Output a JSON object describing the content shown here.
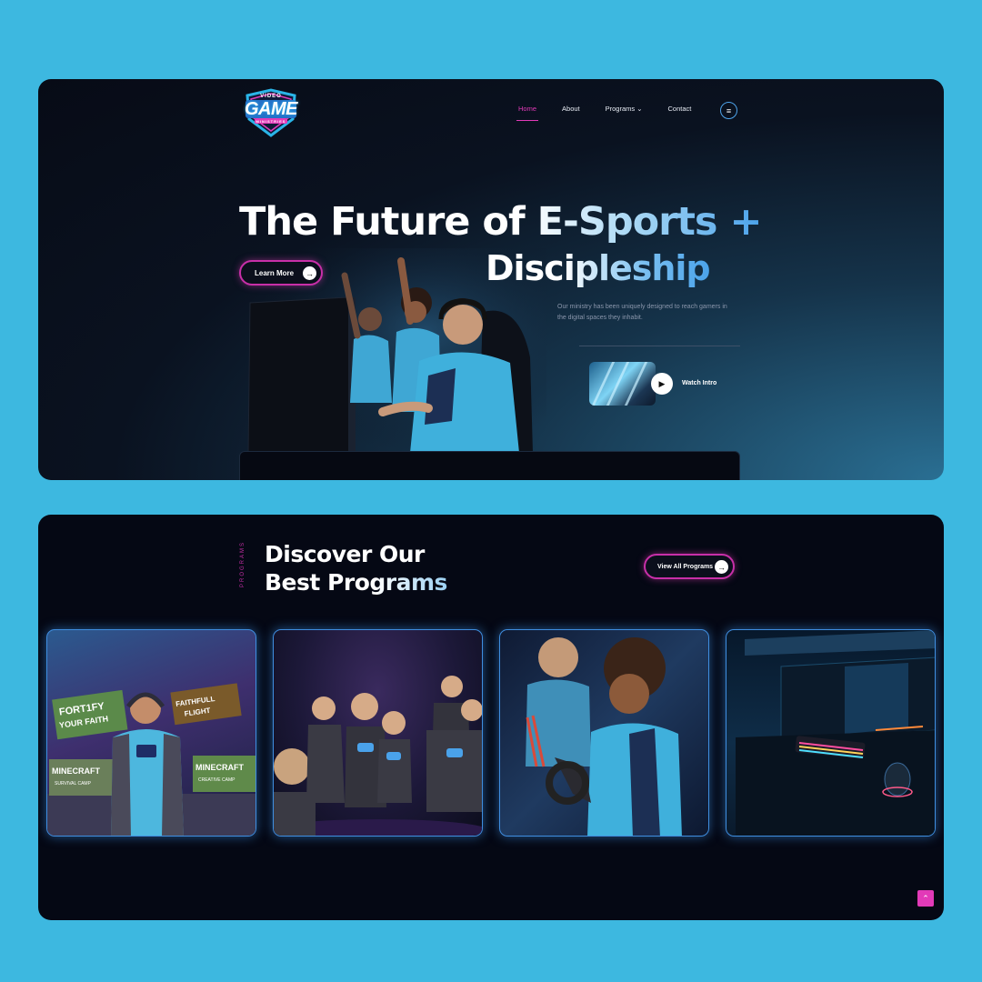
{
  "brand": {
    "logo_top": "VIDEO",
    "logo_main": "GAME",
    "logo_sub": "MINISTRIES"
  },
  "nav": {
    "items": [
      {
        "label": "Home",
        "active": true
      },
      {
        "label": "About"
      },
      {
        "label": "Programs ⌄"
      },
      {
        "label": "Contact"
      }
    ],
    "menu_icon": "hamburger-icon"
  },
  "hero": {
    "headline_line1": "The Future of E-Sports +",
    "headline_line2": "Discipleship",
    "cta_label": "Learn More",
    "description": "Our ministry has been uniquely designed to reach gamers in the digital spaces they inhabit.",
    "watch_label": "Watch Intro"
  },
  "programs": {
    "vertical_label": "PROGRAMS",
    "title_line1": "Discover Our",
    "title_line2": "Best Programs",
    "view_all_label": "View All Programs",
    "cards": [
      {
        "alt": "gamer-with-headset"
      },
      {
        "alt": "kids-group"
      },
      {
        "alt": "esports-team"
      },
      {
        "alt": "gaming-setup"
      }
    ],
    "card1_signs": [
      "FORT1FY YOUR FAITH",
      "FAITHFULL FLIGHT",
      "MINECRAFT SURVIVAL CAMP",
      "MINECRAFT CREATIVE CAMP"
    ]
  },
  "colors": {
    "background": "#3db8e0",
    "accent_pink": "#e23ab8",
    "accent_blue": "#4aa2ea",
    "panel_dark": "#050814"
  }
}
